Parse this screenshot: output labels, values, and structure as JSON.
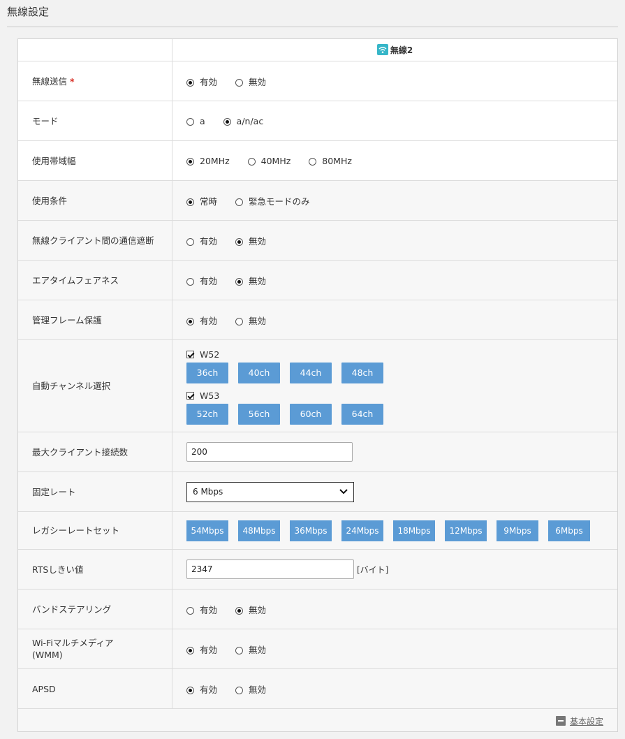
{
  "page": {
    "title": "無線設定"
  },
  "header": {
    "column_title": "無線2",
    "accent_color": "#36b6c8"
  },
  "rows": {
    "transmit": {
      "label": "無線送信",
      "required_mark": "*",
      "options": [
        "有効",
        "無効"
      ],
      "selected": 0
    },
    "mode": {
      "label": "モード",
      "options": [
        "a",
        "a/n/ac"
      ],
      "selected": 1
    },
    "bandwidth": {
      "label": "使用帯域幅",
      "options": [
        "20MHz",
        "40MHz",
        "80MHz"
      ],
      "selected": 0
    },
    "condition": {
      "label": "使用条件",
      "options": [
        "常時",
        "緊急モードのみ"
      ],
      "selected": 0
    },
    "isolation": {
      "label": "無線クライアント間の通信遮断",
      "options": [
        "有効",
        "無効"
      ],
      "selected": 1
    },
    "airtime": {
      "label": "エアタイムフェアネス",
      "options": [
        "有効",
        "無効"
      ],
      "selected": 1
    },
    "pmf": {
      "label": "管理フレーム保護",
      "options": [
        "有効",
        "無効"
      ],
      "selected": 0
    },
    "auto_channel": {
      "label": "自動チャンネル選択",
      "groups": [
        {
          "name": "W52",
          "checked": true,
          "channels": [
            "36ch",
            "40ch",
            "44ch",
            "48ch"
          ]
        },
        {
          "name": "W53",
          "checked": true,
          "channels": [
            "52ch",
            "56ch",
            "60ch",
            "64ch"
          ]
        }
      ]
    },
    "max_clients": {
      "label": "最大クライアント接続数",
      "value": "200"
    },
    "fixed_rate": {
      "label": "固定レート",
      "value": "6 Mbps"
    },
    "legacy_rates": {
      "label": "レガシーレートセット",
      "rates": [
        "54Mbps",
        "48Mbps",
        "36Mbps",
        "24Mbps",
        "18Mbps",
        "12Mbps",
        "9Mbps",
        "6Mbps"
      ]
    },
    "rts": {
      "label": "RTSしきい値",
      "value": "2347",
      "unit": "[バイト]"
    },
    "band_steering": {
      "label": "バンドステアリング",
      "options": [
        "有効",
        "無効"
      ],
      "selected": 1
    },
    "wmm": {
      "label": "Wi-Fiマルチメディア(WMM)",
      "options": [
        "有効",
        "無効"
      ],
      "selected": 0
    },
    "apsd": {
      "label": "APSD",
      "options": [
        "有効",
        "無効"
      ],
      "selected": 0
    }
  },
  "footer": {
    "link_label": "基本設定"
  },
  "colors": {
    "button_blue": "#5b9bd5",
    "required_red": "#d9342b"
  }
}
